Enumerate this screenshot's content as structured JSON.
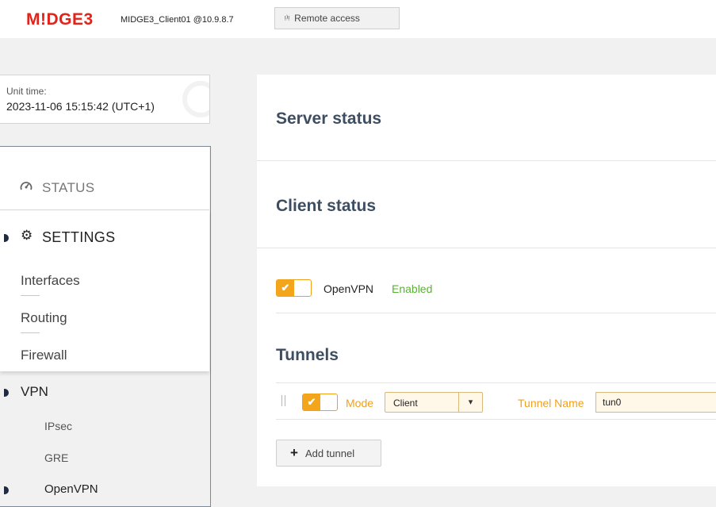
{
  "header": {
    "logo_text": "M!DGE",
    "logo_number": "3",
    "unit_id": "MIDGE3_Client01 @10.9.8.7",
    "remote_access_label": "Remote access",
    "remote_access_icon": "antenna-icon",
    "brand_color": "#e2231a"
  },
  "unit_time": {
    "label": "Unit time:",
    "value": "2023-11-06 15:15:42 (UTC+1)"
  },
  "sidebar": {
    "status_label": "STATUS",
    "status_icon": "gauge-icon",
    "settings_label": "SETTINGS",
    "settings_icon": "gears-icon",
    "settings_items": [
      "Interfaces",
      "Routing",
      "Firewall"
    ],
    "vpn_label": "VPN",
    "vpn_items": [
      "IPsec",
      "GRE",
      "OpenVPN"
    ]
  },
  "main": {
    "server_status_title": "Server status",
    "client_status_title": "Client status",
    "openvpn_label": "OpenVPN",
    "openvpn_state": "Enabled",
    "openvpn_toggle_on": true,
    "tunnels_title": "Tunnels",
    "tunnel": {
      "mode_label": "Mode",
      "mode_value": "Client",
      "name_label": "Tunnel Name",
      "name_value": "tun0",
      "enabled": true
    },
    "add_tunnel_label": "Add tunnel",
    "accent_color": "#f3a51b",
    "enabled_color": "#5ab233"
  }
}
